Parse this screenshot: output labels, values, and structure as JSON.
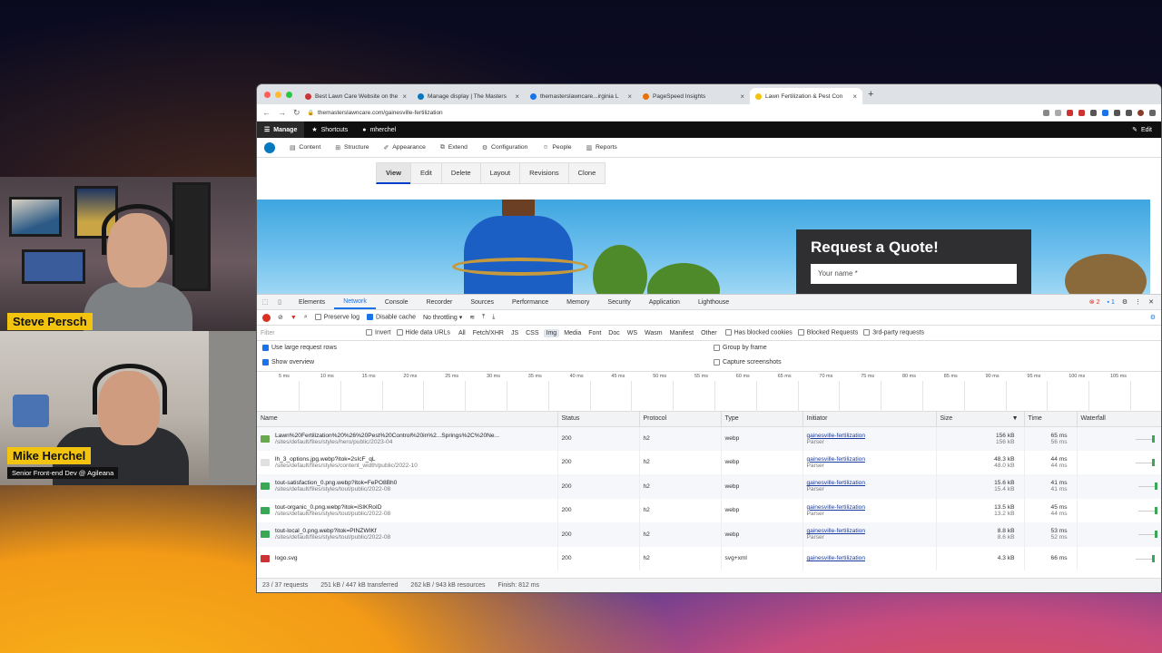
{
  "participants": [
    {
      "name": "Steve Persch",
      "title": ""
    },
    {
      "name": "Mike Herchel",
      "title": "Senior Front-end Dev @ Agileana"
    }
  ],
  "browser": {
    "tabs": [
      {
        "title": "Best Lawn Care Website on the",
        "color": "#c33"
      },
      {
        "title": "Manage display | The Masters",
        "color": "#0678be"
      },
      {
        "title": "themasterslawncare...irginia L",
        "color": "#1a73e8"
      },
      {
        "title": "PageSpeed Insights",
        "color": "#e8710a"
      },
      {
        "title": "Lawn Fertilization & Pest Con",
        "color": "#f2c40f"
      }
    ],
    "new_tab": "+",
    "url": "themasterslawncare.com/gainesville-fertilization"
  },
  "drupal": {
    "toolbar": {
      "manage": "Manage",
      "shortcuts": "Shortcuts",
      "user": "mherchel",
      "edit": "Edit"
    },
    "menu": [
      "Content",
      "Structure",
      "Appearance",
      "Extend",
      "Configuration",
      "People",
      "Reports"
    ],
    "local_tabs": [
      "View",
      "Edit",
      "Delete",
      "Layout",
      "Revisions",
      "Clone"
    ],
    "active_tab": "View"
  },
  "hero": {
    "quote_title": "Request a Quote!",
    "name_placeholder": "Your name *"
  },
  "devtools": {
    "tabs": [
      "Elements",
      "Network",
      "Console",
      "Recorder",
      "Sources",
      "Performance",
      "Memory",
      "Security",
      "Application",
      "Lighthouse"
    ],
    "active_tab": "Network",
    "errors": "2",
    "warnings": "1",
    "toolbar": {
      "preserve_log": "Preserve log",
      "disable_cache": "Disable cache",
      "throttling": "No throttling"
    },
    "filter": {
      "placeholder": "Filter",
      "invert": "Invert",
      "hide_data_urls": "Hide data URLs",
      "types": [
        "All",
        "Fetch/XHR",
        "JS",
        "CSS",
        "Img",
        "Media",
        "Font",
        "Doc",
        "WS",
        "Wasm",
        "Manifest",
        "Other"
      ],
      "selected_type": "Img",
      "has_blocked_cookies": "Has blocked cookies",
      "blocked_requests": "Blocked Requests",
      "third_party": "3rd-party requests"
    },
    "options": {
      "large_rows": "Use large request rows",
      "show_overview": "Show overview",
      "group_by_frame": "Group by frame",
      "capture_screenshots": "Capture screenshots"
    },
    "timeline_ticks": [
      "5 ms",
      "10 ms",
      "15 ms",
      "20 ms",
      "25 ms",
      "30 ms",
      "35 ms",
      "40 ms",
      "45 ms",
      "50 ms",
      "55 ms",
      "60 ms",
      "65 ms",
      "70 ms",
      "75 ms",
      "80 ms",
      "85 ms",
      "90 ms",
      "95 ms",
      "100 ms",
      "105 ms"
    ],
    "columns": [
      "Name",
      "Status",
      "Protocol",
      "Type",
      "Initiator",
      "Size",
      "Time",
      "Waterfall"
    ],
    "rows": [
      {
        "name": "Lawn%20Fertilization%20%26%20Pest%20Control%20in%2...Springs%2C%20Ne...",
        "path": "/sites/default/files/styles/hero/public/2023-04",
        "status": "200",
        "protocol": "h2",
        "type": "webp",
        "initiator": "gainesville-fertilization",
        "initiator_sub": "Parser",
        "size": "156 kB",
        "size_sub": "156 kB",
        "time": "65 ms",
        "time_sub": "56 ms",
        "thumb": "#6aa84f",
        "wf_start": 0.92,
        "wf_len": 0.04
      },
      {
        "name": "lh_3_options.jpg.webp?itok=2sIcF_qL",
        "path": "/sites/default/files/styles/content_width/public/2022-10",
        "status": "200",
        "protocol": "h2",
        "type": "webp",
        "initiator": "gainesville-fertilization",
        "initiator_sub": "Parser",
        "size": "48.3 kB",
        "size_sub": "48.0 kB",
        "time": "44 ms",
        "time_sub": "44 ms",
        "thumb": "#e0e0e0",
        "wf_start": 0.92,
        "wf_len": 0.03
      },
      {
        "name": "tout-satisfaction_0.png.webp?itok=FePO8Bh0",
        "path": "/sites/default/files/styles/tout/public/2022-08",
        "status": "200",
        "protocol": "h2",
        "type": "webp",
        "initiator": "gainesville-fertilization",
        "initiator_sub": "Parser",
        "size": "15.6 kB",
        "size_sub": "15.4 kB",
        "time": "41 ms",
        "time_sub": "41 ms",
        "thumb": "#3aa757",
        "wf_start": 0.96,
        "wf_len": 0.02
      },
      {
        "name": "tout-organic_0.png.webp?itok=iSIKRoID",
        "path": "/sites/default/files/styles/tout/public/2022-08",
        "status": "200",
        "protocol": "h2",
        "type": "webp",
        "initiator": "gainesville-fertilization",
        "initiator_sub": "Parser",
        "size": "13.5 kB",
        "size_sub": "13.2 kB",
        "time": "45 ms",
        "time_sub": "44 ms",
        "thumb": "#3aa757",
        "wf_start": 0.96,
        "wf_len": 0.02
      },
      {
        "name": "tout-local_0.png.webp?itok=PINZWIKf",
        "path": "/sites/default/files/styles/tout/public/2022-08",
        "status": "200",
        "protocol": "h2",
        "type": "webp",
        "initiator": "gainesville-fertilization",
        "initiator_sub": "Parser",
        "size": "8.8 kB",
        "size_sub": "8.6 kB",
        "time": "53 ms",
        "time_sub": "52 ms",
        "thumb": "#3aa757",
        "wf_start": 0.96,
        "wf_len": 0.025
      },
      {
        "name": "logo.svg",
        "path": "",
        "status": "200",
        "protocol": "h2",
        "type": "svg+xml",
        "initiator": "gainesville-fertilization",
        "initiator_sub": "",
        "size": "4.3 kB",
        "size_sub": "",
        "time": "66 ms",
        "time_sub": "",
        "thumb": "#c33",
        "wf_start": 0.92,
        "wf_len": 0.035
      }
    ],
    "summary": {
      "requests": "23 / 37 requests",
      "transferred": "251 kB / 447 kB transferred",
      "resources": "262 kB / 943 kB resources",
      "finish": "Finish: 812 ms"
    }
  }
}
